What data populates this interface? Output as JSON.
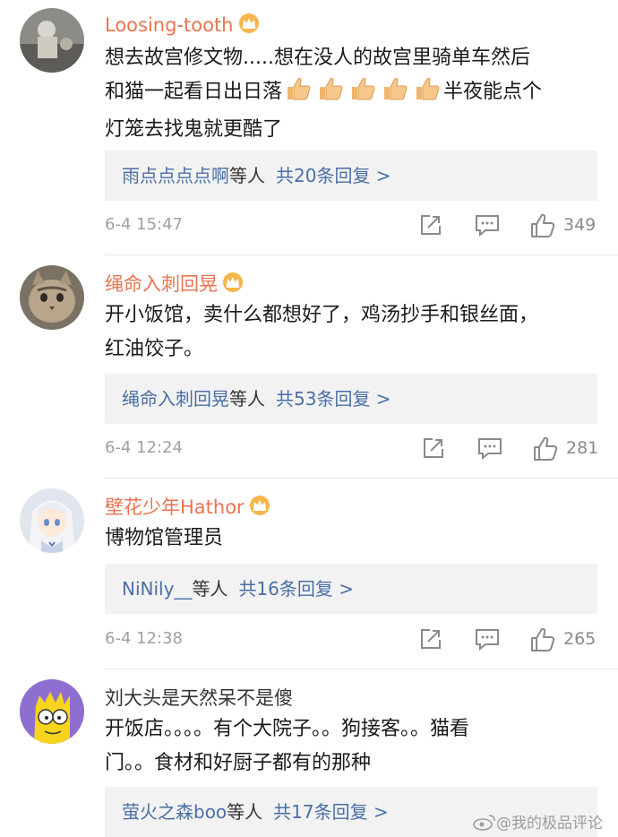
{
  "comments": [
    {
      "username": "Loosing-tooth",
      "vip": true,
      "text_lines": [
        "想去故宫修文物.....想在没人的故宫里骑单车然后",
        "和猫一起看日出日落",
        "灯笼去找鬼就更酷了"
      ],
      "text_after_emoji": "半夜能点个",
      "emoji": "thumbs-up",
      "reply_user": "雨点点点点啊",
      "reply_mid": "等人",
      "reply_count": "共20条回复 >",
      "time": "6-4 15:47",
      "likes": "349"
    },
    {
      "username": "绳命入刺回晃",
      "vip": true,
      "text_lines": [
        "开小饭馆，卖什么都想好了，鸡汤抄手和银丝面，",
        "红油饺子。"
      ],
      "reply_user": "绳命入刺回晃",
      "reply_mid": "等人",
      "reply_count": "共53条回复 >",
      "time": "6-4 12:24",
      "likes": "281"
    },
    {
      "username": "壁花少年Hathor",
      "vip": true,
      "text_lines": [
        "博物馆管理员"
      ],
      "reply_user": "NiNily__",
      "reply_mid": "等人",
      "reply_count": "共16条回复 >",
      "time": "6-4 12:38",
      "likes": "265"
    },
    {
      "username": "刘大头是天然呆不是傻",
      "vip": false,
      "text_lines": [
        "开饭店。。。。有个大院子。。狗接客。。猫看",
        "门。。食材和好厨子都有的那种"
      ],
      "reply_user": "萤火之森boo",
      "reply_mid": "等人",
      "reply_count": "共17条回复 >"
    }
  ],
  "watermark": "@我的极品评论",
  "colors": {
    "vip_name": "#eb7350",
    "link_blue": "#4a6fa5",
    "reply_bg": "#f2f2f2",
    "meta_gray": "#a0a0a0"
  },
  "icons": [
    "crown-vip-icon",
    "thumbs-up-emoji-icon",
    "share-icon",
    "comment-icon",
    "like-icon",
    "weibo-logo-icon"
  ]
}
